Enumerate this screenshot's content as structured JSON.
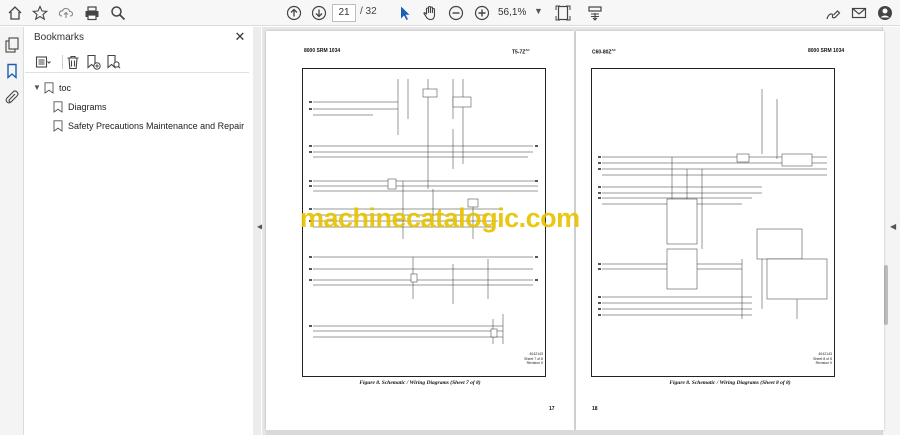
{
  "toolbar": {
    "current_page": "21",
    "total_pages": "/ 32",
    "zoom": "56,1%",
    "icons": [
      "home-icon",
      "star-icon",
      "upload-icon",
      "print-icon",
      "search-icon",
      "page-up-icon",
      "page-down-icon",
      "select-arrow-icon",
      "hand-icon",
      "zoom-out-icon",
      "zoom-in-icon",
      "page-fit-icon",
      "scroll-mode-icon",
      "sign-icon",
      "mail-icon",
      "account-icon"
    ]
  },
  "bookmarks": {
    "title": "Bookmarks",
    "items": [
      {
        "label": "toc",
        "level": 0,
        "expanded": true
      },
      {
        "label": "Diagrams",
        "level": 1
      },
      {
        "label": "Safety Precautions Maintenance and Repair",
        "level": 1
      }
    ]
  },
  "pages": {
    "left": {
      "header_left": "8000 SRM 1034",
      "header_right": "T5-7Z",
      "caption": "Figure 8. Schematic / Wiring Diagrams (Sheet 7 of 8)",
      "page_number": "17",
      "meta": [
        "4042143",
        "Sheet 7 of 8",
        "Revision 9"
      ]
    },
    "right": {
      "header_left": "C60-80Z",
      "header_right": "8000 SRM 1034",
      "caption": "Figure 8. Schematic / Wiring Diagrams (Sheet 8 of 8)",
      "page_number": "18",
      "meta": [
        "4042143",
        "Sheet 8 of 8",
        "Revision 9"
      ]
    }
  },
  "watermark": "machinecatalogic.com"
}
